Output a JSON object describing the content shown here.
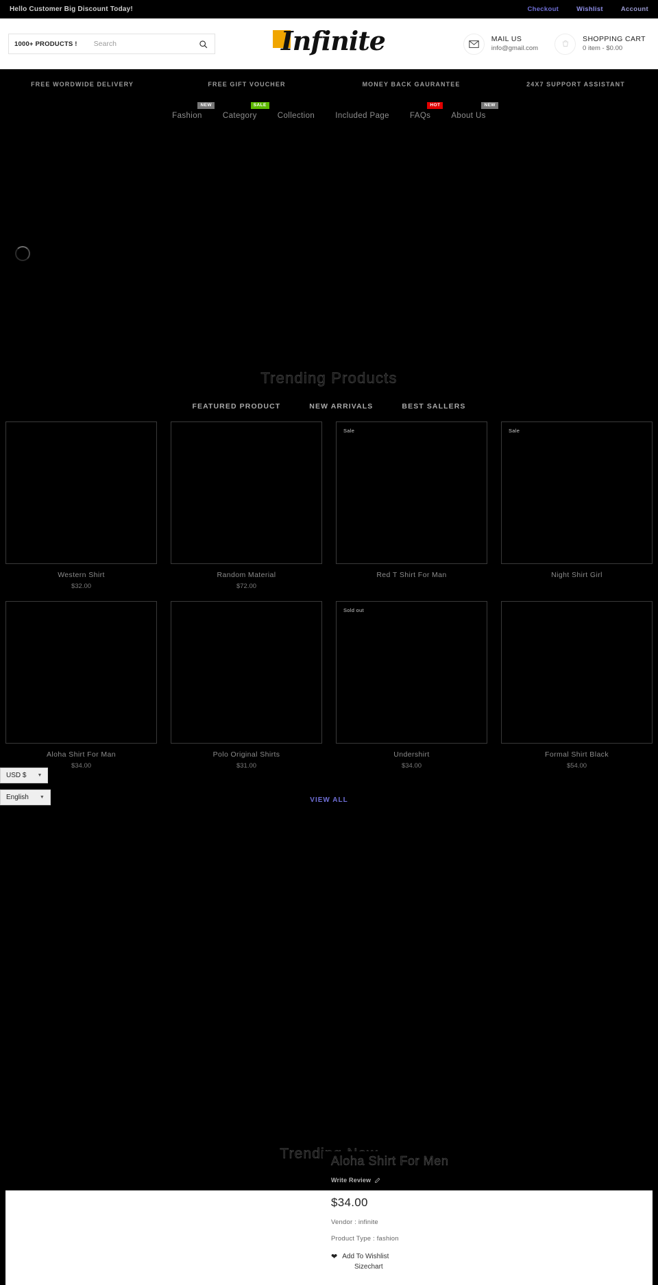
{
  "topbar": {
    "announcement": "Hello Customer Big Discount Today!",
    "links": [
      {
        "label": "Checkout"
      },
      {
        "label": "Wishlist"
      },
      {
        "label": "Account"
      }
    ]
  },
  "header": {
    "search": {
      "tag": "1000+ PRODUCTS !",
      "placeholder": "Search",
      "value": "",
      "icon": "search-icon"
    },
    "logo": {
      "text": "Infinite",
      "accent_color": "#f0a500"
    },
    "mail": {
      "icon": "envelope-icon",
      "title": "MAIL US",
      "sub": "info@gmail.com"
    },
    "cart": {
      "icon": "cart-icon",
      "title": "SHOPPING CART",
      "sub": "0 item - $0.00"
    }
  },
  "promo": {
    "items": [
      "FREE WORDWIDE DELIVERY",
      "FREE GIFT VOUCHER",
      "MONEY BACK GAURANTEE",
      "24X7 SUPPORT ASSISTANT"
    ]
  },
  "nav": {
    "items": [
      {
        "label": "Fashion",
        "badge": "NEW",
        "badge_type": "new"
      },
      {
        "label": "Category",
        "badge": "SALE",
        "badge_type": "sale"
      },
      {
        "label": "Collection",
        "badge": "",
        "badge_type": ""
      },
      {
        "label": "Included Page",
        "badge": "",
        "badge_type": ""
      },
      {
        "label": "FAQs",
        "badge": "HOT",
        "badge_type": "hot"
      },
      {
        "label": "About Us",
        "badge": "NEW",
        "badge_type": "new"
      }
    ]
  },
  "trending": {
    "title": "Trending Products",
    "tabs": [
      {
        "label": "FEATURED PRODUCT",
        "active": true
      },
      {
        "label": "NEW ARRIVALS",
        "active": false
      },
      {
        "label": "BEST SALLERS",
        "active": false
      }
    ],
    "products": [
      {
        "name": "Western Shirt",
        "price": "$32.00",
        "tag": ""
      },
      {
        "name": "Random Material",
        "price": "$72.00",
        "tag": ""
      },
      {
        "name": "Red T Shirt For Man",
        "price": "",
        "tag": "Sale"
      },
      {
        "name": "Night Shirt Girl",
        "price": "",
        "tag": "Sale"
      },
      {
        "name": "Aloha Shirt For Man",
        "price": "$34.00",
        "tag": ""
      },
      {
        "name": "Polo Original Shirts",
        "price": "$31.00",
        "tag": ""
      },
      {
        "name": "Undershirt",
        "price": "$34.00",
        "tag": "Sold out"
      },
      {
        "name": "Formal Shirt Black",
        "price": "$54.00",
        "tag": ""
      }
    ],
    "view_all": "VIEW ALL"
  },
  "floating": {
    "currency": {
      "value": "USD $",
      "caret": "chevron-down-icon"
    },
    "language": {
      "value": "English",
      "caret": "chevron-down-icon"
    }
  },
  "trending_now": {
    "title": "Trending Now",
    "product": {
      "name": "Aloha Shirt For Men",
      "write_review": "Write Review",
      "review_icon": "pencil-icon",
      "price": "$34.00",
      "vendor": "Vendor : infinite",
      "product_type": "Product Type : fashion",
      "wishlist": "Add To Wishlist",
      "wishlist_icon": "heart-icon",
      "sizechart": "Sizechart"
    }
  }
}
